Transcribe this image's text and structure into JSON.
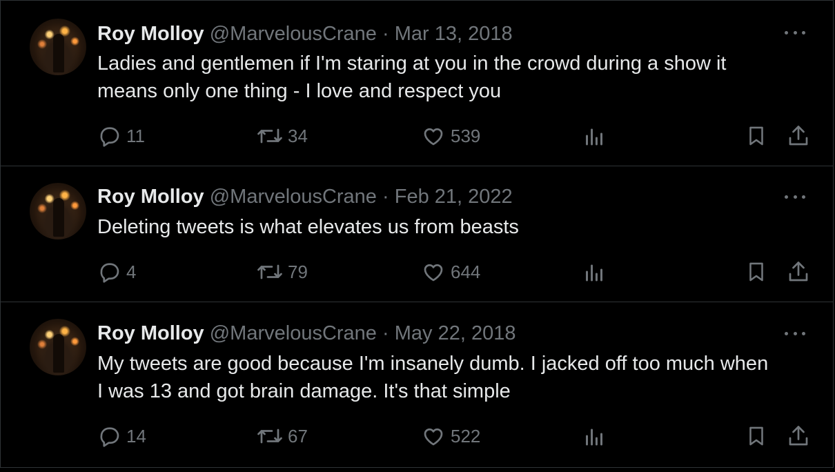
{
  "colors": {
    "background": "#000000",
    "text": "#e7e9ea",
    "muted": "#71767b",
    "border": "#2f3336"
  },
  "tweets": [
    {
      "name": "Roy Molloy",
      "handle": "@MarvelousCrane",
      "separator": "·",
      "date": "Mar 13, 2018",
      "text_lines": [
        "Ladies and gentlemen if I'm staring at you in the crowd during a show it",
        "means only one thing - I love and respect you"
      ],
      "replies": "11",
      "retweets": "34",
      "likes": "539",
      "icons": [
        "reply-icon",
        "retweet-icon",
        "like-icon",
        "views-icon",
        "bookmark-icon",
        "share-icon"
      ]
    },
    {
      "name": "Roy Molloy",
      "handle": "@MarvelousCrane",
      "separator": "·",
      "date": "Feb 21, 2022",
      "text_lines": [
        "Deleting tweets is what elevates us from beasts"
      ],
      "replies": "4",
      "retweets": "79",
      "likes": "644",
      "icons": [
        "reply-icon",
        "retweet-icon",
        "like-icon",
        "views-icon",
        "bookmark-icon",
        "share-icon"
      ]
    },
    {
      "name": "Roy Molloy",
      "handle": "@MarvelousCrane",
      "separator": "·",
      "date": "May 22, 2018",
      "text_lines": [
        "My tweets are good because I'm insanely dumb. I jacked off too much when",
        "I was 13 and got brain damage. It's that simple"
      ],
      "replies": "14",
      "retweets": "67",
      "likes": "522",
      "icons": [
        "reply-icon",
        "retweet-icon",
        "like-icon",
        "views-icon",
        "bookmark-icon",
        "share-icon"
      ]
    }
  ]
}
